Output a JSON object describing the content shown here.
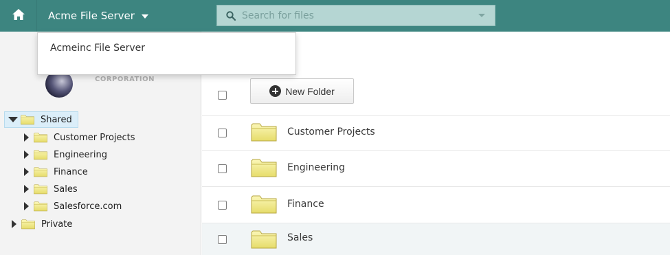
{
  "colors": {
    "topbar": "#3d8580",
    "search_bg": "#b5d6d3",
    "folder_fill": "#f2ec8c",
    "folder_stroke": "#b6a640",
    "selected_bg": "#dbeef9"
  },
  "header": {
    "home_icon": "home-icon",
    "server_label": "Acme File Server",
    "search": {
      "placeholder": "Search for files",
      "value": ""
    }
  },
  "dropdown": {
    "items": [
      {
        "label": "Acmeinc File Server"
      }
    ]
  },
  "sidebar": {
    "logo_text": "CORPORATION",
    "tree": [
      {
        "label": "Shared",
        "expanded": true,
        "selected": true,
        "level": 0
      },
      {
        "label": "Customer Projects",
        "expanded": false,
        "level": 1
      },
      {
        "label": "Engineering",
        "expanded": false,
        "level": 1
      },
      {
        "label": "Finance",
        "expanded": false,
        "level": 1
      },
      {
        "label": "Sales",
        "expanded": false,
        "level": 1
      },
      {
        "label": "Salesforce.com",
        "expanded": false,
        "level": 1
      },
      {
        "label": "Private",
        "expanded": false,
        "level": 0
      }
    ]
  },
  "main": {
    "new_folder_label": "New Folder",
    "rows": [
      {
        "label": "Customer Projects"
      },
      {
        "label": "Engineering"
      },
      {
        "label": "Finance"
      },
      {
        "label": "Sales",
        "highlighted": true
      }
    ]
  }
}
